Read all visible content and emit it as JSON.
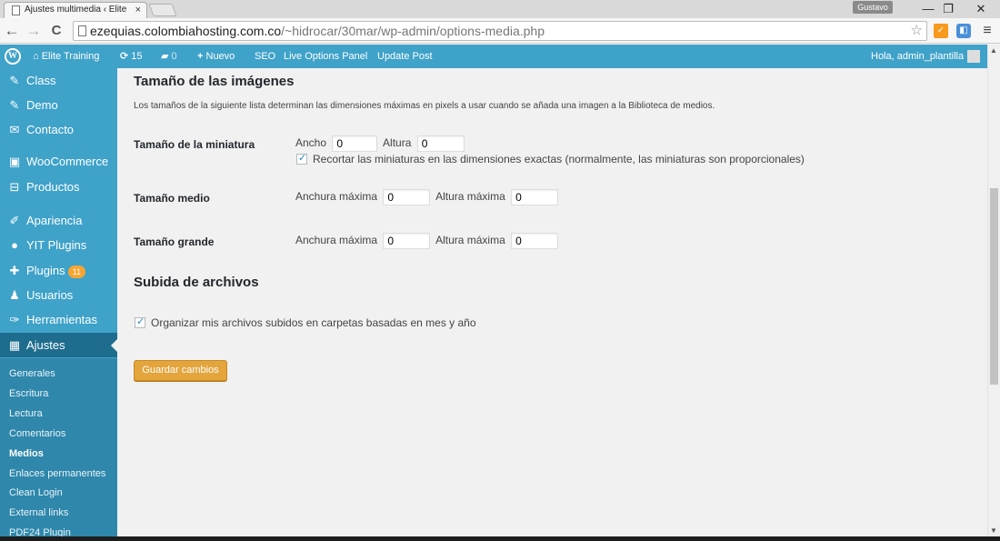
{
  "browser": {
    "tab_title": "Ajustes multimedia ‹ Elite",
    "tab_close": "×",
    "profile_name": "Gustavo",
    "window_minimize": "—",
    "window_restore": "❐",
    "window_close": "✕",
    "back": "←",
    "forward": "→",
    "reload": "C",
    "url_host": "ezequias.colombiahosting.com.co",
    "url_path": "/~hidrocar/30mar/wp-admin/options-media.php",
    "star": "☆",
    "menu": "≡"
  },
  "adminbar": {
    "logo": "W",
    "site_name": "Elite Training",
    "updates_count": "15",
    "comments_count": "0",
    "new_label": "Nuevo",
    "seo_label": "SEO",
    "live_options_label": "Live Options Panel",
    "update_post_label": "Update Post",
    "greeting": "Hola, admin_plantilla"
  },
  "sidebar": {
    "items": [
      {
        "label": "Class",
        "icon": "pin-icon",
        "glyph": "✎"
      },
      {
        "label": "Demo",
        "icon": "pin-icon",
        "glyph": "✎"
      },
      {
        "label": "Contacto",
        "icon": "mail-icon",
        "glyph": "✉"
      },
      {
        "label": "WooCommerce",
        "icon": "woocommerce-icon",
        "glyph": "▣"
      },
      {
        "label": "Productos",
        "icon": "cart-icon",
        "glyph": "⊟"
      },
      {
        "label": "Apariencia",
        "icon": "brush-icon",
        "glyph": "✐"
      },
      {
        "label": "YIT Plugins",
        "icon": "yit-icon",
        "glyph": "●"
      },
      {
        "label": "Plugins",
        "icon": "plugin-icon",
        "glyph": "✚",
        "badge": "11"
      },
      {
        "label": "Usuarios",
        "icon": "user-icon",
        "glyph": "♟"
      },
      {
        "label": "Herramientas",
        "icon": "wrench-icon",
        "glyph": "✑"
      },
      {
        "label": "Ajustes",
        "icon": "settings-icon",
        "glyph": "▦"
      }
    ],
    "submenu": [
      "Generales",
      "Escritura",
      "Lectura",
      "Comentarios",
      "Medios",
      "Enlaces permanentes",
      "Clean Login",
      "External links",
      "PDF24 Plugin"
    ]
  },
  "main": {
    "image_sizes_heading": "Tamaño de las imágenes",
    "image_sizes_desc": "Los tamaños de la siguiente lista determinan las dimensiones máximas en pixels a usar cuando se añada una imagen a la Biblioteca de medios.",
    "thumbnail_label": "Tamaño de la miniatura",
    "width_label": "Ancho",
    "thumb_width": "0",
    "height_label": "Altura",
    "thumb_height": "0",
    "crop_label": "Recortar las miniaturas en las dimensiones exactas (normalmente, las miniaturas son proporcionales)",
    "medium_label": "Tamaño medio",
    "max_width_label": "Anchura máxima",
    "medium_width": "0",
    "max_height_label": "Altura máxima",
    "medium_height": "0",
    "large_label": "Tamaño grande",
    "large_width": "0",
    "large_height": "0",
    "uploads_heading": "Subida de archivos",
    "organize_label": "Organizar mis archivos subidos en carpetas basadas en mes y año",
    "save_label": "Guardar cambios"
  }
}
